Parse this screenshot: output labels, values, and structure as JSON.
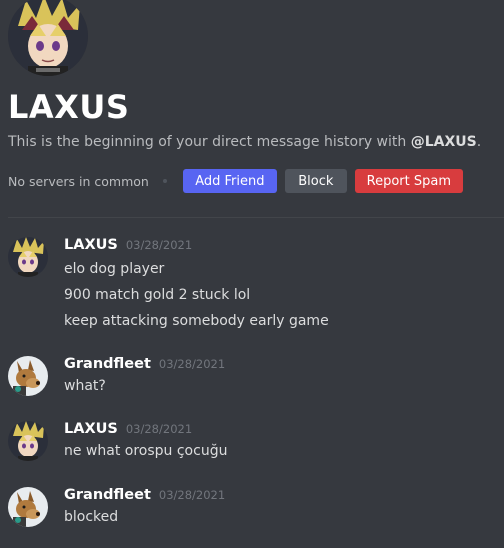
{
  "profile": {
    "username": "LAXUS",
    "intro_prefix": "This is the beginning of your direct message history with ",
    "intro_handle": "@LAXUS",
    "intro_suffix": ".",
    "no_servers": "No servers in common",
    "add_friend_label": "Add Friend",
    "block_label": "Block",
    "report_spam_label": "Report Spam",
    "avatar_icon": "yugi-avatar-icon"
  },
  "colors": {
    "background": "#36393f",
    "add_friend": "#5865f2",
    "block": "#4f545c",
    "report_spam": "#d83c3e"
  },
  "messages": [
    {
      "author": "LAXUS",
      "timestamp": "03/28/2021",
      "avatar_icon": "yugi-avatar-icon",
      "lines": [
        "elo dog player",
        "900 match gold 2 stuck lol",
        "keep attacking somebody early game"
      ]
    },
    {
      "author": "Grandfleet",
      "timestamp": "03/28/2021",
      "avatar_icon": "dog-avatar-icon",
      "lines": [
        "what?"
      ]
    },
    {
      "author": "LAXUS",
      "timestamp": "03/28/2021",
      "avatar_icon": "yugi-avatar-icon",
      "lines": [
        "ne what orospu çocuğu"
      ]
    },
    {
      "author": "Grandfleet",
      "timestamp": "03/28/2021",
      "avatar_icon": "dog-avatar-icon",
      "lines": [
        "blocked"
      ]
    }
  ]
}
